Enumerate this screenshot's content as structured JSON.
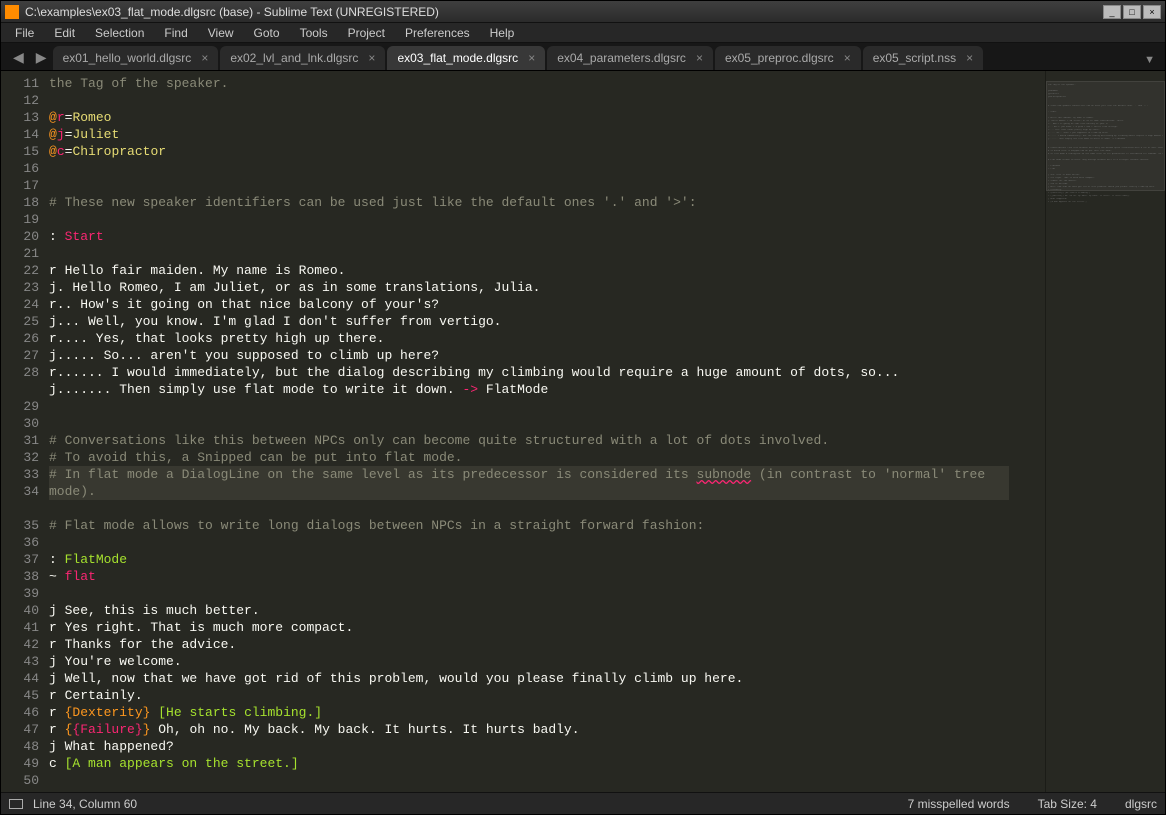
{
  "window": {
    "title": "C:\\examples\\ex03_flat_mode.dlgsrc (base) - Sublime Text (UNREGISTERED)"
  },
  "menu": {
    "items": [
      "File",
      "Edit",
      "Selection",
      "Find",
      "View",
      "Goto",
      "Tools",
      "Project",
      "Preferences",
      "Help"
    ]
  },
  "tabs": {
    "items": [
      {
        "label": "ex01_hello_world.dlgsrc",
        "active": false
      },
      {
        "label": "ex02_lvl_and_lnk.dlgsrc",
        "active": false
      },
      {
        "label": "ex03_flat_mode.dlgsrc",
        "active": true
      },
      {
        "label": "ex04_parameters.dlgsrc",
        "active": false
      },
      {
        "label": "ex05_preproc.dlgsrc",
        "active": false
      },
      {
        "label": "ex05_script.nss",
        "active": false
      }
    ]
  },
  "editor": {
    "first_line": 11,
    "current_line": 34,
    "lines": [
      {
        "n": 11,
        "raw": "the Tag of the speaker.",
        "cls": "comment"
      },
      {
        "n": 12,
        "raw": ""
      },
      {
        "n": 13,
        "raw": "@r=Romeo",
        "cls": "def",
        "id": "r",
        "name": "Romeo"
      },
      {
        "n": 14,
        "raw": "@j=Juliet",
        "cls": "def",
        "id": "j",
        "name": "Juliet"
      },
      {
        "n": 15,
        "raw": "@c=Chiropractor",
        "cls": "def",
        "id": "c",
        "name": "Chiropractor"
      },
      {
        "n": 16,
        "raw": ""
      },
      {
        "n": 17,
        "raw": ""
      },
      {
        "n": 18,
        "raw": "# These new speaker identifiers can be used just like the default ones '.' and '>':",
        "cls": "comment"
      },
      {
        "n": 19,
        "raw": ""
      },
      {
        "n": 20,
        "raw": ": Start",
        "cls": "label",
        "label": "Start"
      },
      {
        "n": 21,
        "raw": ""
      },
      {
        "n": 22,
        "raw": "r Hello fair maiden. My name is Romeo."
      },
      {
        "n": 23,
        "raw": "j. Hello Romeo, I am Juliet, or as in some translations, Julia."
      },
      {
        "n": 24,
        "raw": "r.. How's it going on that nice balcony of your's?"
      },
      {
        "n": 25,
        "raw": "j... Well, you know. I'm glad I don't suffer from vertigo."
      },
      {
        "n": 26,
        "raw": "r.... Yes, that looks pretty high up there."
      },
      {
        "n": 27,
        "raw": "j..... So... aren't you supposed to climb up here?"
      },
      {
        "n": 28,
        "raw": "r...... I would immediately, but the dialog describing my climbing would require a huge amount of dots, so..."
      },
      {
        "n": 29,
        "raw": "j....... Then simply use flat mode to write it down. -> FlatMode",
        "cls": "arrowline",
        "pre": "j....... Then simply use flat mode to write it down. ",
        "arrow": "->",
        "target": " FlatMode"
      },
      {
        "n": 30,
        "raw": ""
      },
      {
        "n": 31,
        "raw": ""
      },
      {
        "n": 32,
        "raw": "# Conversations like this between NPCs only can become quite structured with a lot of dots involved.",
        "cls": "comment"
      },
      {
        "n": 33,
        "raw": "# To avoid this, a Snipped can be put into flat mode.",
        "cls": "comment"
      },
      {
        "n": 34,
        "raw": "# In flat mode a DialogLine on the same level as its predecessor is considered its subnode (in contrast to 'normal' tree mode).",
        "cls": "comment",
        "current": true,
        "wavy": "subnode"
      },
      {
        "n": 35,
        "raw": ""
      },
      {
        "n": 36,
        "raw": "# Flat mode allows to write long dialogs between NPCs in a straight forward fashion:",
        "cls": "comment"
      },
      {
        "n": 37,
        "raw": ""
      },
      {
        "n": 38,
        "raw": ": FlatMode",
        "cls": "label2",
        "label": "FlatMode"
      },
      {
        "n": 39,
        "raw": "~ flat",
        "cls": "flat"
      },
      {
        "n": 40,
        "raw": ""
      },
      {
        "n": 41,
        "raw": "j See, this is much better."
      },
      {
        "n": 42,
        "raw": "r Yes right. That is much more compact."
      },
      {
        "n": 43,
        "raw": "r Thanks for the advice."
      },
      {
        "n": 44,
        "raw": "j You're welcome."
      },
      {
        "n": 45,
        "raw": "j Well, now that we have got rid of this problem, would you please finally climb up here."
      },
      {
        "n": 46,
        "raw": "r Certainly."
      },
      {
        "n": 47,
        "raw": "r {Dexterity} [He starts climbing.]",
        "cls": "mix47"
      },
      {
        "n": 48,
        "raw": "r {{Failure}} Oh, oh no. My back. My back. It hurts. It hurts badly.",
        "cls": "mix48"
      },
      {
        "n": 49,
        "raw": "j What happened?"
      },
      {
        "n": 50,
        "raw": "c [A man appears on the street.]",
        "cls": "mix50"
      }
    ]
  },
  "status": {
    "position": "Line 34, Column 60",
    "spell": "7 misspelled words",
    "tab": "Tab Size: 4",
    "syntax": "dlgsrc"
  }
}
